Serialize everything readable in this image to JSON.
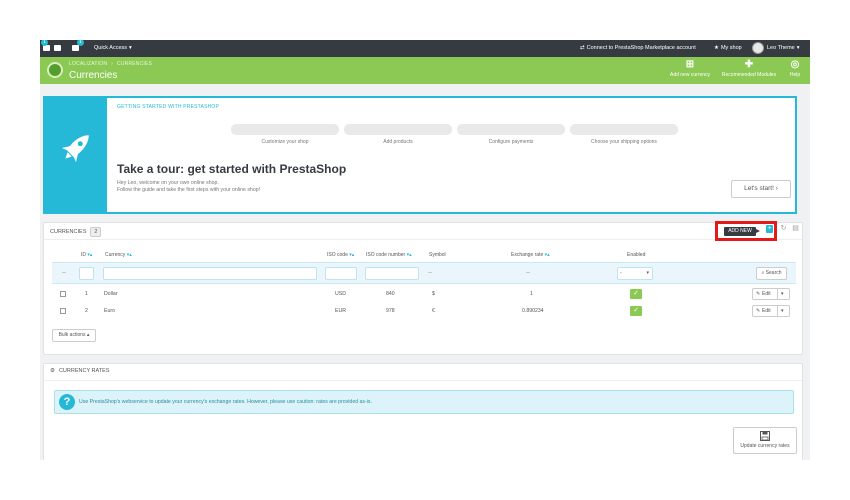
{
  "topbar": {
    "badge_1": "1",
    "badge_2": "1",
    "quick_access": "Quick Access",
    "marketplace": "Connect to PrestaShop Marketplace account",
    "my_shop": "My shop",
    "theme": "Leo Theme"
  },
  "header": {
    "breadcrumb": [
      "LOCALIZATION",
      "CURRENCIES"
    ],
    "title": "Currencies",
    "buttons": [
      "Add new currency",
      "Recommended Modules",
      "Help"
    ]
  },
  "onboarding": {
    "heading": "GETTING STARTED WITH PRESTASHOP",
    "steps": [
      "Customize your shop",
      "Add products",
      "Configure payments",
      "Choose your shipping options"
    ],
    "tour_title": "Take a tour: get started with PrestaShop",
    "welcome_line1": "Hey Leo, welcome on your own online shop.",
    "welcome_line2": "Follow the guide and take the first steps with your online shop!",
    "start_button": "Let's start!"
  },
  "currencies": {
    "title": "CURRENCIES",
    "count": "2",
    "add_new": "ADD NEW",
    "columns": [
      "ID",
      "Currency",
      "ISO code",
      "ISO code number",
      "Symbol",
      "Exchange rate",
      "Enabled"
    ],
    "filter_dash": "--",
    "enabled_filter": "-",
    "search_button": "Search",
    "rows": [
      {
        "id": "1",
        "currency": "Dollar",
        "iso": "USD",
        "iso_num": "840",
        "symbol": "$",
        "rate": "1",
        "edit": "Edit"
      },
      {
        "id": "2",
        "currency": "Euro",
        "iso": "EUR",
        "iso_num": "978",
        "symbol": "€",
        "rate": "0.890234",
        "edit": "Edit"
      }
    ],
    "bulk_actions": "Bulk actions"
  },
  "rates": {
    "title": "CURRENCY RATES",
    "info": "Use PrestaShop's webservice to update your currency's exchange rates. However, please use caution: rates are provided as-is.",
    "update_button": "Update currency rates"
  },
  "colors": {
    "accent": "#25b9d7",
    "header_green": "#8bc954",
    "topbar": "#363a41",
    "highlight_red": "#e41a1a"
  }
}
